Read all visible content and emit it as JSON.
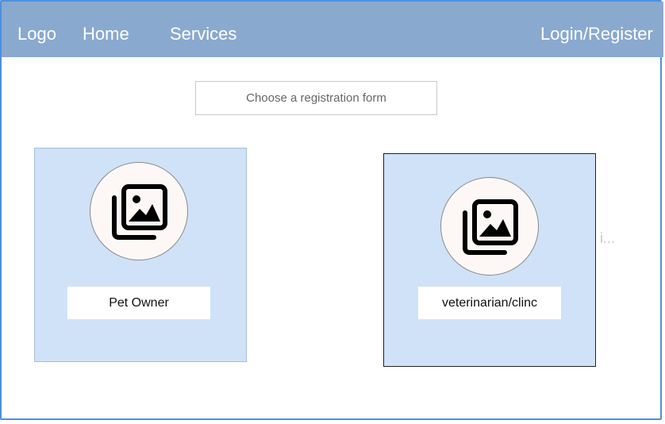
{
  "navbar": {
    "logo": "Logo",
    "home": "Home",
    "services": "Services",
    "login": "Login/Register"
  },
  "main": {
    "choose_label": "Choose a registration form",
    "cards": [
      {
        "label": "Pet Owner",
        "icon": "image-gallery-icon"
      },
      {
        "label": "veterinarian/clinc",
        "icon": "image-gallery-icon"
      }
    ],
    "overflow_text": "i..."
  },
  "colors": {
    "navbar_bg": "#8aa9cf",
    "card_bg": "#cfe2f8",
    "frame_border": "#4a90e2"
  }
}
